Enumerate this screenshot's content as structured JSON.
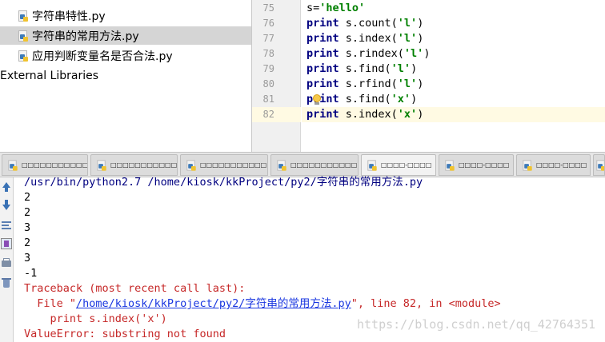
{
  "project_tree": {
    "items": [
      {
        "label": "字符串特性.py",
        "selected": false
      },
      {
        "label": "字符串的常用方法.py",
        "selected": true
      },
      {
        "label": "应用判断变量名是否合法.py",
        "selected": false
      }
    ],
    "external_libraries": "External Libraries"
  },
  "editor": {
    "line_numbers": [
      "75",
      "76",
      "77",
      "78",
      "79",
      "80",
      "81",
      "82"
    ],
    "lines": [
      {
        "kw": "",
        "rest": "s=",
        "str": "'hello'",
        "tail": ""
      },
      {
        "kw": "print",
        "rest": " s.count(",
        "str": "'l'",
        "tail": ")"
      },
      {
        "kw": "print",
        "rest": " s.index(",
        "str": "'l'",
        "tail": ")"
      },
      {
        "kw": "print",
        "rest": " s.rindex(",
        "str": "'l'",
        "tail": ")"
      },
      {
        "kw": "print",
        "rest": " s.find(",
        "str": "'l'",
        "tail": ")"
      },
      {
        "kw": "print",
        "rest": " s.rfind(",
        "str": "'l'",
        "tail": ")"
      },
      {
        "kw": "print",
        "rest": " s.find(",
        "str": "'x'",
        "tail": ")"
      },
      {
        "kw": "print",
        "rest": " s.index(",
        "str": "'x'",
        "tail": ")"
      }
    ],
    "current_line": "82"
  },
  "run_tabs": [
    {
      "label": "□□□□□□□□□□□"
    },
    {
      "label": "□□□□□□□□□□□"
    },
    {
      "label": "□□□□□□□□□□□"
    },
    {
      "label": "□□□□□□□□□□□"
    },
    {
      "label": "□□□□-□□□□"
    },
    {
      "label": "□□□□-□□□□"
    },
    {
      "label": "□□□□-□□□□"
    },
    {
      "label": "□"
    }
  ],
  "console": {
    "command_path": "/usr/bin/python2.7 /home/kiosk/kkProject/py2/",
    "command_file": "字符串的常用方法.py",
    "outputs": [
      "2",
      "2",
      "3",
      "2",
      "3",
      "-1"
    ],
    "traceback_header": "Traceback (most recent call last):",
    "file_prefix": "  File \"",
    "file_link": "/home/kiosk/kkProject/py2/字符串的常用方法.py",
    "file_suffix": "\", line 82, in <module>",
    "code_line": "    print s.index('x')",
    "error_line": "ValueError: substring not found"
  },
  "watermark": "https://blog.csdn.net/qq_42764351"
}
